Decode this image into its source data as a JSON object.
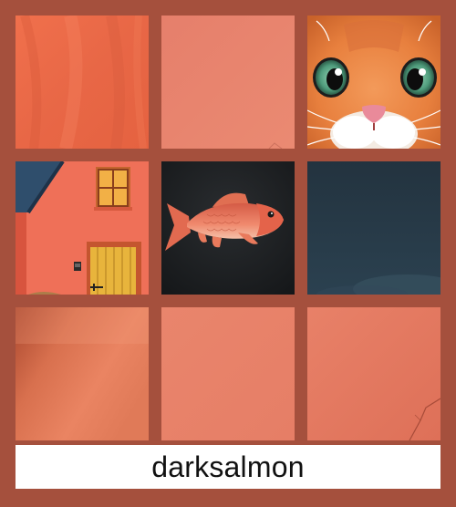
{
  "caption": "darksalmon",
  "grid": {
    "rows": 3,
    "columns": 3,
    "tiles": [
      {
        "id": "tile-1",
        "icon": "salmon-fabric-texture-image"
      },
      {
        "id": "tile-2",
        "icon": "salmon-plain-texture-image"
      },
      {
        "id": "tile-3",
        "icon": "orange-cat-face-image"
      },
      {
        "id": "tile-4",
        "icon": "salmon-house-door-image"
      },
      {
        "id": "tile-5",
        "icon": "red-fish-image"
      },
      {
        "id": "tile-6",
        "icon": "dark-teal-sky-image"
      },
      {
        "id": "tile-7",
        "icon": "salmon-gradient-texture-image"
      },
      {
        "id": "tile-8",
        "icon": "salmon-flat-texture-image"
      },
      {
        "id": "tile-9",
        "icon": "salmon-wall-texture-image"
      }
    ]
  },
  "colors": {
    "frame": "#a5503d",
    "salmon": "#e9967a",
    "label_bg": "#ffffff",
    "label_text": "#111111"
  }
}
